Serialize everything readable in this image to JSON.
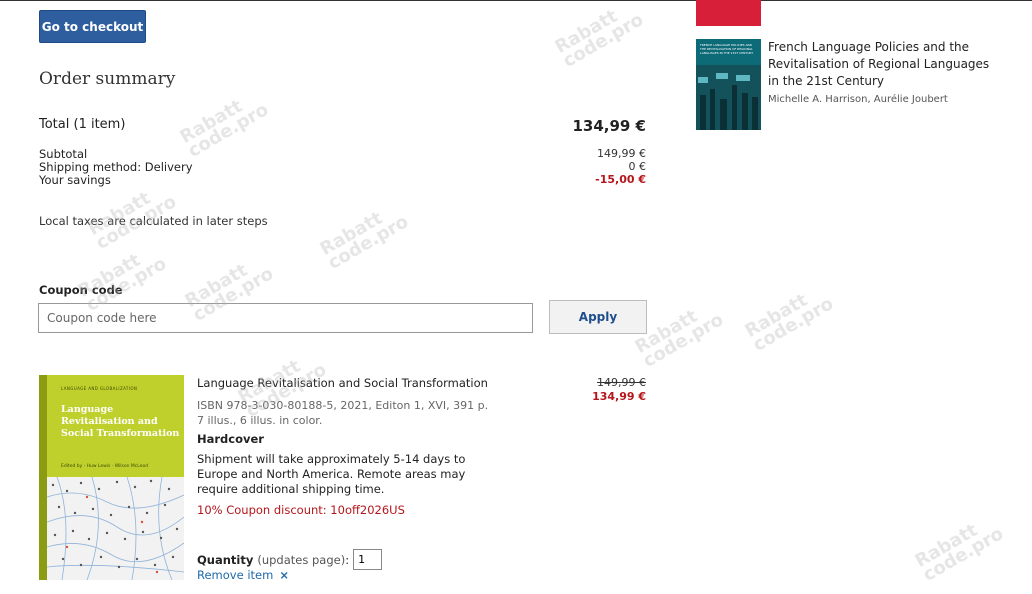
{
  "checkout": {
    "button_label": "Go to checkout"
  },
  "summary": {
    "title": "Order summary",
    "total_label": "Total (1 item)",
    "total_value": "134,99 €",
    "lines": [
      {
        "label": "Subtotal",
        "value": "149,99 €"
      },
      {
        "label": "Shipping method: Delivery",
        "value": "0 €"
      },
      {
        "label": "Your savings",
        "value": "-15,00 €"
      }
    ],
    "taxes_note": "Local taxes are calculated in later steps"
  },
  "coupon": {
    "label": "Coupon code",
    "placeholder": "Coupon code here",
    "apply_label": "Apply"
  },
  "item": {
    "cover": {
      "series": "LANGUAGE AND GLOBALIZATION",
      "title": "Language Revitalisation and Social Transformation",
      "editors": "Edited by · Huw Lewis · Wilson McLeod"
    },
    "title": "Language Revitalisation and Social Transformation",
    "meta": "ISBN 978-3-030-80188-5, 2021, Editon 1, XVI, 391 p. 7 illus., 6 illus. in color.",
    "format": "Hardcover",
    "shipping": "Shipment will take approximately 5-14 days to Europe and North America. Remote areas may require additional shipping time.",
    "coupon_note": "10% Coupon discount: 10off2026US",
    "old_price": "149,99 €",
    "new_price": "134,99 €",
    "quantity_label": "Quantity",
    "quantity_note": "(updates page)",
    "quantity_colon": ":",
    "quantity_value": "1",
    "remove_label": "Remove item",
    "remove_icon": "×"
  },
  "related": {
    "cover_text": "FRENCH LANGUAGE POLICIES AND THE REVITALISATION OF REGIONAL LANGUAGES IN THE 21ST CENTURY",
    "title": "French Language Policies and the Revitalisation of Regional Languages in the 21st Century",
    "authors": "Michelle A. Harrison, Aurélie Joubert"
  },
  "watermark": {
    "line1": "Rabatt",
    "line2": "code.pro"
  },
  "colors": {
    "accent": "#2f5e9e",
    "sale": "#b5161b",
    "link": "#1f6aa8"
  }
}
